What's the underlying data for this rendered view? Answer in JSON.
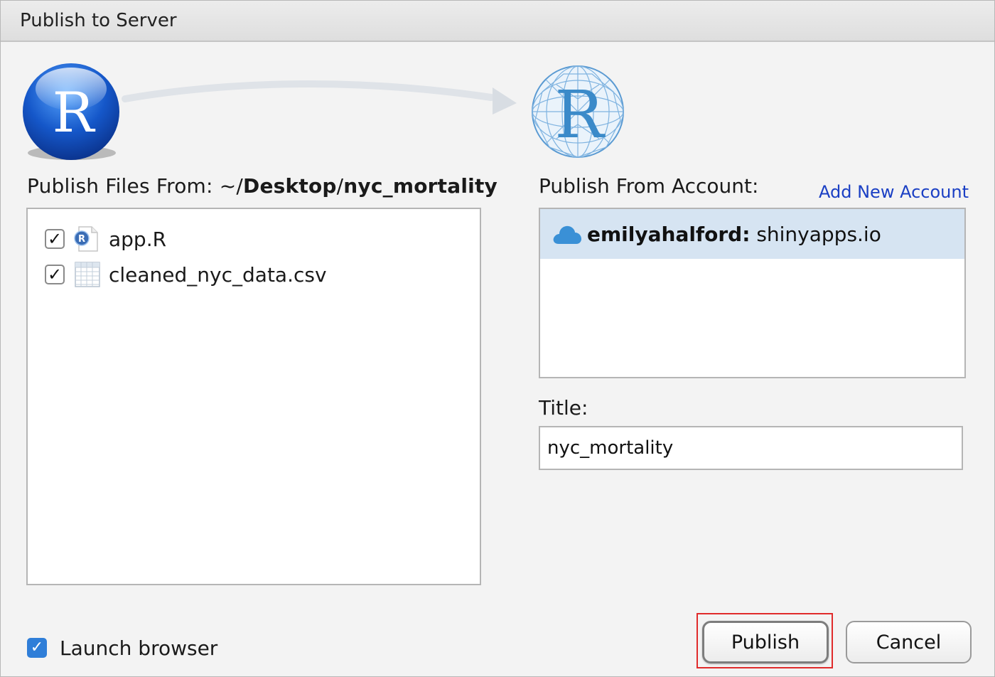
{
  "window": {
    "title": "Publish to Server"
  },
  "files_section": {
    "label_prefix": "Publish Files From: ~/",
    "path_part1": "Desktop",
    "path_sep": "/",
    "path_part2": "nyc_mortality",
    "files": [
      {
        "name": "app.R",
        "checked": true,
        "icon": "r-script-file-icon"
      },
      {
        "name": "cleaned_nyc_data.csv",
        "checked": true,
        "icon": "csv-spreadsheet-icon"
      }
    ]
  },
  "account_section": {
    "label": "Publish From Account:",
    "add_account_link": "Add New Account",
    "accounts": [
      {
        "user": "emilyahalford:",
        "server": "shinyapps.io",
        "selected": true,
        "icon": "cloud-icon"
      }
    ]
  },
  "title_field": {
    "label": "Title:",
    "value": "nyc_mortality"
  },
  "launch_browser": {
    "label": "Launch browser",
    "checked": true
  },
  "buttons": {
    "publish": "Publish",
    "cancel": "Cancel"
  },
  "colors": {
    "accent": "#2f7ed8",
    "link": "#1a3fc4",
    "selected_row": "#d6e4f2",
    "highlight": "#e02b2b"
  }
}
